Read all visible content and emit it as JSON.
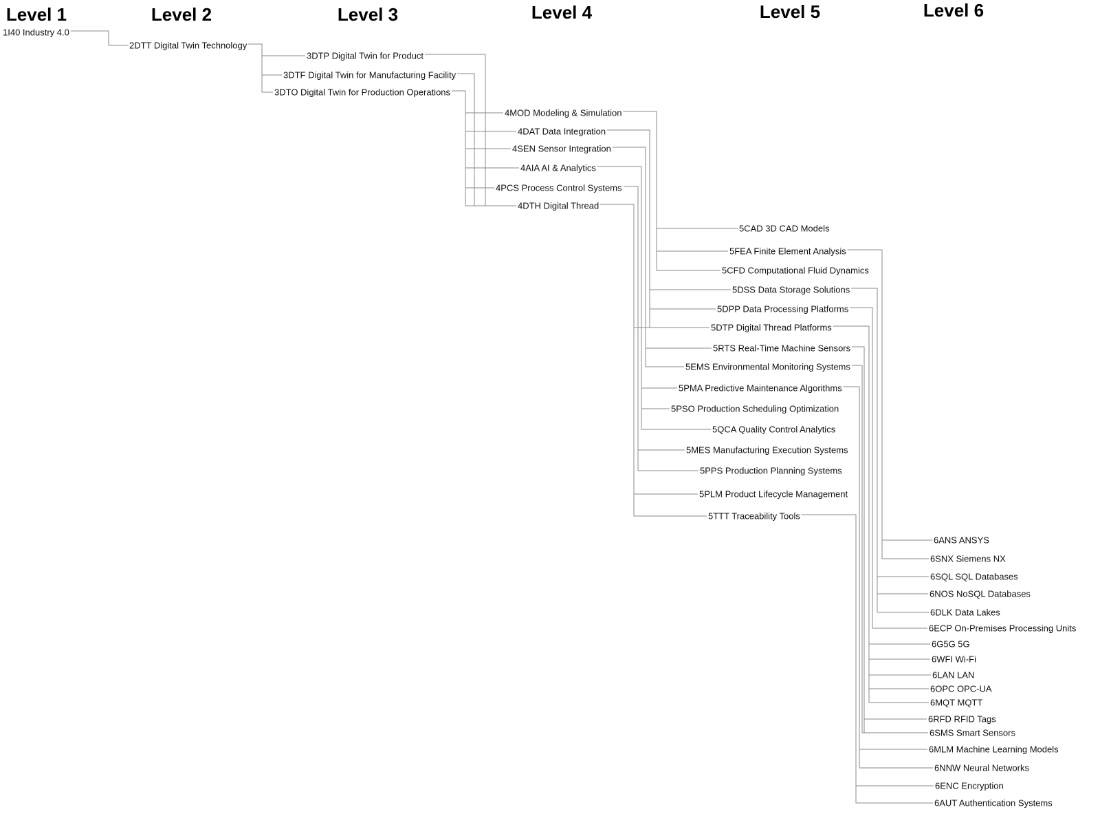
{
  "levels": [
    "Level 1",
    "Level 2",
    "Level 3",
    "Level 4",
    "Level 5",
    "Level 6"
  ],
  "nodes": [
    {
      "id": "1I40",
      "label": "1I40 Industry 4.0",
      "level": 1
    },
    {
      "id": "2DTT",
      "label": "2DTT Digital Twin Technology",
      "level": 2,
      "parents": [
        "1I40"
      ]
    },
    {
      "id": "3DTP",
      "label": "3DTP Digital Twin for Product",
      "level": 3,
      "parents": [
        "2DTT"
      ]
    },
    {
      "id": "3DTF",
      "label": "3DTF Digital Twin for Manufacturing Facility",
      "level": 3,
      "parents": [
        "2DTT"
      ]
    },
    {
      "id": "3DTO",
      "label": "3DTO Digital Twin for Production Operations",
      "level": 3,
      "parents": [
        "2DTT"
      ]
    },
    {
      "id": "4MOD",
      "label": "4MOD Modeling & Simulation",
      "level": 4,
      "parents": [
        "3DTP",
        "3DTF",
        "3DTO"
      ]
    },
    {
      "id": "4DAT",
      "label": "4DAT Data Integration",
      "level": 4,
      "parents": [
        "3DTP",
        "3DTF",
        "3DTO"
      ]
    },
    {
      "id": "4SEN",
      "label": "4SEN Sensor Integration",
      "level": 4,
      "parents": [
        "3DTP",
        "3DTF",
        "3DTO"
      ]
    },
    {
      "id": "4AIA",
      "label": "4AIA AI & Analytics",
      "level": 4,
      "parents": [
        "3DTP",
        "3DTF",
        "3DTO"
      ]
    },
    {
      "id": "4PCS",
      "label": "4PCS Process Control Systems",
      "level": 4,
      "parents": [
        "3DTP",
        "3DTF",
        "3DTO"
      ]
    },
    {
      "id": "4DTH",
      "label": "4DTH Digital Thread",
      "level": 4,
      "parents": [
        "3DTP",
        "3DTF",
        "3DTO"
      ]
    },
    {
      "id": "5CAD",
      "label": "5CAD 3D CAD Models",
      "level": 5,
      "parents": [
        "4MOD"
      ]
    },
    {
      "id": "5FEA",
      "label": "5FEA Finite Element Analysis",
      "level": 5,
      "parents": [
        "4MOD"
      ]
    },
    {
      "id": "5CFD",
      "label": "5CFD Computational Fluid Dynamics",
      "level": 5,
      "parents": [
        "4MOD"
      ]
    },
    {
      "id": "5DSS",
      "label": "5DSS Data Storage Solutions",
      "level": 5,
      "parents": [
        "4DAT"
      ]
    },
    {
      "id": "5DPP",
      "label": "5DPP Data Processing Platforms",
      "level": 5,
      "parents": [
        "4DAT"
      ]
    },
    {
      "id": "5DTP",
      "label": "5DTP Digital Thread Platforms",
      "level": 5,
      "parents": [
        "4DAT",
        "4DTH"
      ]
    },
    {
      "id": "5RTS",
      "label": "5RTS Real-Time Machine Sensors",
      "level": 5,
      "parents": [
        "4SEN"
      ]
    },
    {
      "id": "5EMS",
      "label": "5EMS Environmental Monitoring Systems",
      "level": 5,
      "parents": [
        "4SEN"
      ]
    },
    {
      "id": "5PMA",
      "label": "5PMA Predictive Maintenance Algorithms",
      "level": 5,
      "parents": [
        "4AIA"
      ]
    },
    {
      "id": "5PSO",
      "label": "5PSO Production Scheduling Optimization",
      "level": 5,
      "parents": [
        "4AIA"
      ]
    },
    {
      "id": "5QCA",
      "label": "5QCA Quality Control Analytics",
      "level": 5,
      "parents": [
        "4AIA"
      ]
    },
    {
      "id": "5MES",
      "label": "5MES Manufacturing Execution Systems",
      "level": 5,
      "parents": [
        "4PCS"
      ]
    },
    {
      "id": "5PPS",
      "label": "5PPS Production Planning Systems",
      "level": 5,
      "parents": [
        "4PCS"
      ]
    },
    {
      "id": "5PLM",
      "label": "5PLM Product Lifecycle Management",
      "level": 5,
      "parents": [
        "4DTH"
      ]
    },
    {
      "id": "5TTT",
      "label": "5TTT Traceability Tools",
      "level": 5,
      "parents": [
        "4DTH"
      ]
    },
    {
      "id": "6ANS",
      "label": "6ANS ANSYS",
      "level": 6,
      "parents": [
        "5FEA"
      ]
    },
    {
      "id": "6SNX",
      "label": "6SNX Siemens NX",
      "level": 6,
      "parents": [
        "5FEA"
      ]
    },
    {
      "id": "6SQL",
      "label": "6SQL SQL Databases",
      "level": 6,
      "parents": [
        "5DSS"
      ]
    },
    {
      "id": "6NOS",
      "label": "6NOS NoSQL Databases",
      "level": 6,
      "parents": [
        "5DSS"
      ]
    },
    {
      "id": "6DLK",
      "label": "6DLK Data Lakes",
      "level": 6,
      "parents": [
        "5DSS"
      ]
    },
    {
      "id": "6ECP",
      "label": "6ECP On-Premises Processing Units",
      "level": 6,
      "parents": [
        "5DPP"
      ]
    },
    {
      "id": "6G5G",
      "label": "6G5G 5G",
      "level": 6,
      "parents": [
        "5DTP"
      ]
    },
    {
      "id": "6WFI",
      "label": "6WFI Wi-Fi",
      "level": 6,
      "parents": [
        "5DTP"
      ]
    },
    {
      "id": "6LAN",
      "label": "6LAN LAN",
      "level": 6,
      "parents": [
        "5DTP"
      ]
    },
    {
      "id": "6OPC",
      "label": "6OPC OPC-UA",
      "level": 6,
      "parents": [
        "5DTP"
      ]
    },
    {
      "id": "6MQT",
      "label": "6MQT MQTT",
      "level": 6,
      "parents": [
        "5DTP"
      ]
    },
    {
      "id": "6RFD",
      "label": "6RFD RFID Tags",
      "level": 6,
      "parents": [
        "5RTS"
      ]
    },
    {
      "id": "6SMS",
      "label": "6SMS Smart Sensors",
      "level": 6,
      "parents": [
        "5RTS",
        "5EMS"
      ]
    },
    {
      "id": "6MLM",
      "label": "6MLM Machine Learning Models",
      "level": 6,
      "parents": [
        "5PMA"
      ]
    },
    {
      "id": "6NNW",
      "label": "6NNW Neural Networks",
      "level": 6,
      "parents": [
        "5PMA"
      ]
    },
    {
      "id": "6ENC",
      "label": "6ENC Encryption",
      "level": 6,
      "parents": [
        "5TTT"
      ]
    },
    {
      "id": "6AUT",
      "label": "6AUT Authentication Systems",
      "level": 6,
      "parents": [
        "5TTT"
      ]
    }
  ],
  "colors": {
    "edge": "#8a8a8a",
    "text": "#111111"
  }
}
